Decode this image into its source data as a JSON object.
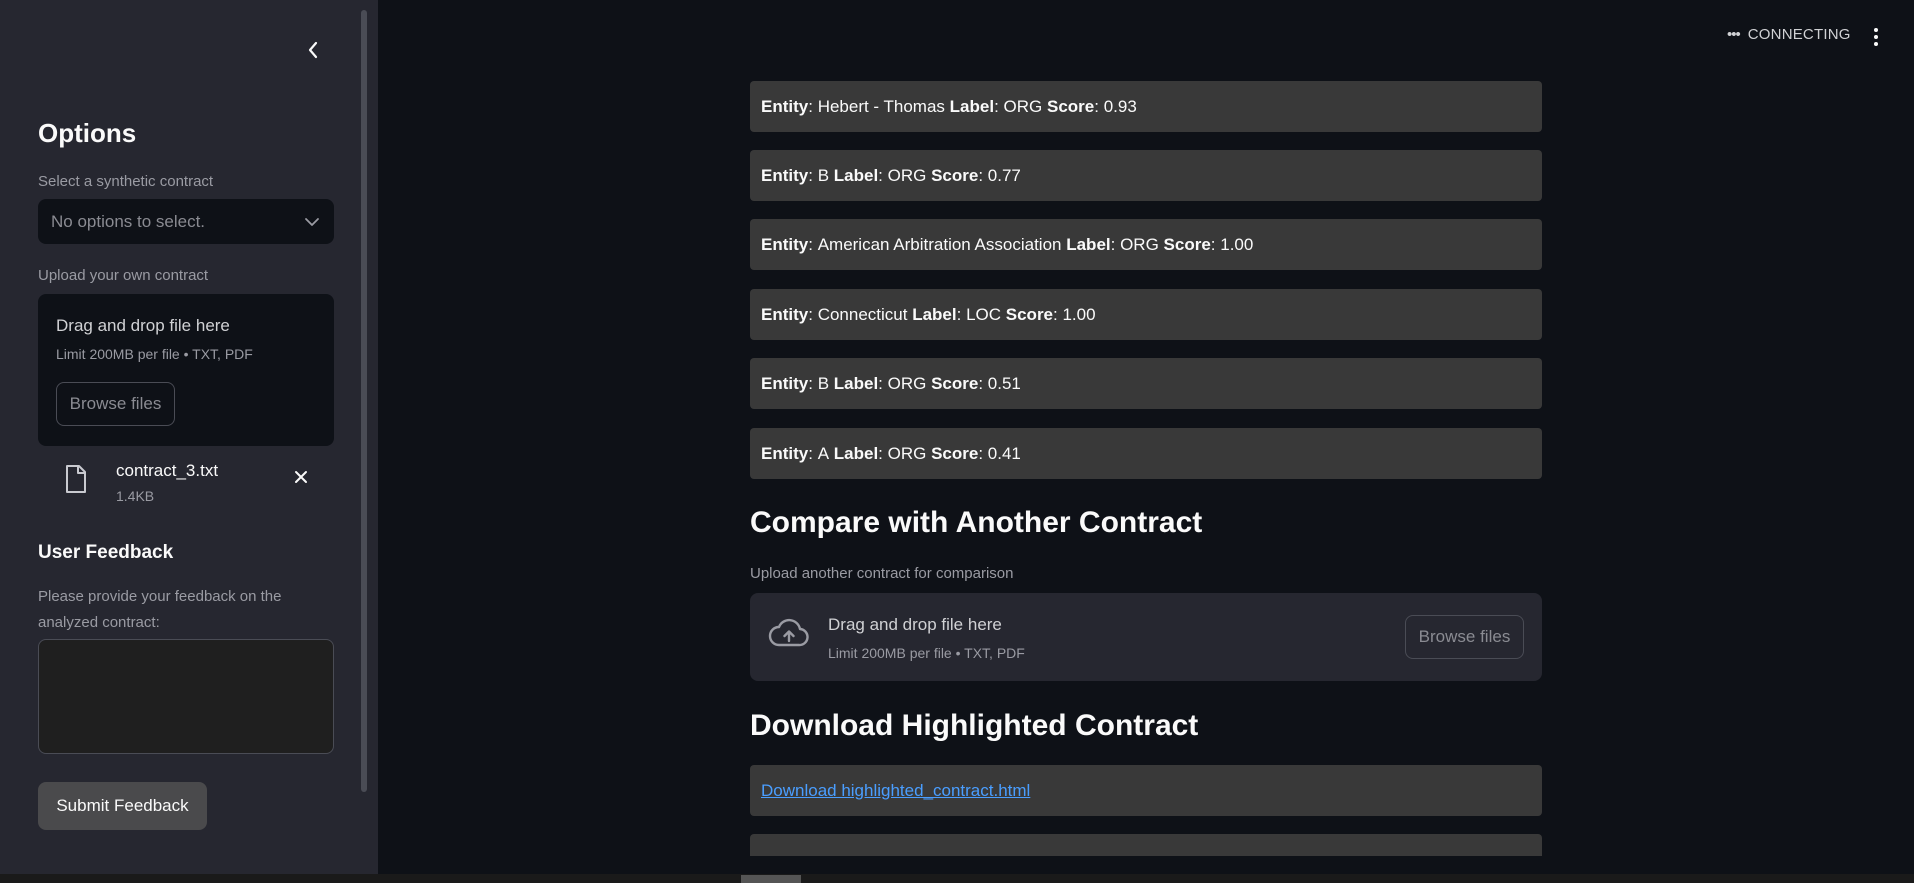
{
  "sidebar": {
    "title": "Options",
    "select_label": "Select a synthetic contract",
    "select_placeholder": "No options to select.",
    "upload_label": "Upload your own contract",
    "dropzone_title": "Drag and drop file here",
    "dropzone_limit": "Limit 200MB per file • TXT, PDF",
    "browse_label": "Browse files",
    "file": {
      "name": "contract_3.txt",
      "size": "1.4KB"
    },
    "feedback_heading": "User Feedback",
    "feedback_label": "Please provide your feedback on the analyzed contract:",
    "feedback_value": "",
    "submit_label": "Submit Feedback"
  },
  "header": {
    "status": "CONNECTING"
  },
  "main": {
    "entities": [
      {
        "entity_key": "Entity",
        "entity": "Hebert - Thomas",
        "label_key": "Label",
        "label": "ORG",
        "score_key": "Score",
        "score": "0.93"
      },
      {
        "entity_key": "Entity",
        "entity": "B",
        "label_key": "Label",
        "label": "ORG",
        "score_key": "Score",
        "score": "0.77"
      },
      {
        "entity_key": "Entity",
        "entity": "American Arbitration Association",
        "label_key": "Label",
        "label": "ORG",
        "score_key": "Score",
        "score": "1.00"
      },
      {
        "entity_key": "Entity",
        "entity": "Connecticut",
        "label_key": "Label",
        "label": "LOC",
        "score_key": "Score",
        "score": "1.00"
      },
      {
        "entity_key": "Entity",
        "entity": "B",
        "label_key": "Label",
        "label": "ORG",
        "score_key": "Score",
        "score": "0.51"
      },
      {
        "entity_key": "Entity",
        "entity": "A",
        "label_key": "Label",
        "label": "ORG",
        "score_key": "Score",
        "score": "0.41"
      }
    ],
    "compare_heading": "Compare with Another Contract",
    "compare_label": "Upload another contract for comparison",
    "compare_dropzone_title": "Drag and drop file here",
    "compare_dropzone_limit": "Limit 200MB per file • TXT, PDF",
    "compare_browse_label": "Browse files",
    "download_heading": "Download Highlighted Contract",
    "download_link": "Download highlighted_contract.html"
  },
  "colors": {
    "background": "#0e1117",
    "sidebar": "#262730",
    "entity_box": "#393939",
    "link": "#4a9eff"
  }
}
